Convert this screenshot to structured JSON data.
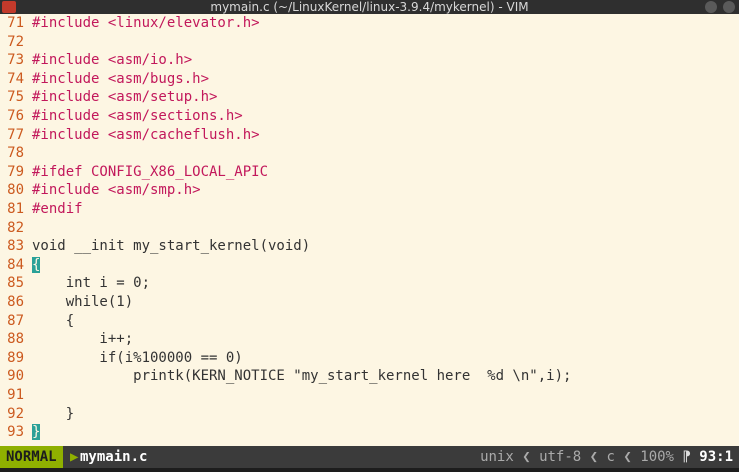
{
  "window": {
    "title": "mymain.c (~/LinuxKernel/linux-3.9.4/mykernel) - VIM"
  },
  "editor": {
    "lines": [
      {
        "n": "71",
        "text": "#include <linux/elevator.h>"
      },
      {
        "n": "72",
        "text": ""
      },
      {
        "n": "73",
        "text": "#include <asm/io.h>"
      },
      {
        "n": "74",
        "text": "#include <asm/bugs.h>"
      },
      {
        "n": "75",
        "text": "#include <asm/setup.h>"
      },
      {
        "n": "76",
        "text": "#include <asm/sections.h>"
      },
      {
        "n": "77",
        "text": "#include <asm/cacheflush.h>"
      },
      {
        "n": "78",
        "text": ""
      },
      {
        "n": "79",
        "text": "#ifdef CONFIG_X86_LOCAL_APIC"
      },
      {
        "n": "80",
        "text": "#include <asm/smp.h>"
      },
      {
        "n": "81",
        "text": "#endif"
      },
      {
        "n": "82",
        "text": ""
      },
      {
        "n": "83",
        "text": "void __init my_start_kernel(void)"
      },
      {
        "n": "84",
        "text": "{"
      },
      {
        "n": "85",
        "text": "    int i = 0;"
      },
      {
        "n": "86",
        "text": "    while(1)"
      },
      {
        "n": "87",
        "text": "    {"
      },
      {
        "n": "88",
        "text": "        i++;"
      },
      {
        "n": "89",
        "text": "        if(i%100000 == 0)"
      },
      {
        "n": "90",
        "text": "            printk(KERN_NOTICE \"my_start_kernel here  %d \\n\",i);"
      },
      {
        "n": "91",
        "text": ""
      },
      {
        "n": "92",
        "text": "    }"
      },
      {
        "n": "93",
        "text": "}"
      }
    ]
  },
  "status": {
    "mode": "NORMAL",
    "filename": "mymain.c",
    "fileformat": "unix",
    "encoding": "utf-8",
    "filetype": "c",
    "percent": "100%",
    "position": "93:1"
  },
  "colors": {
    "mode_bg": "#8fb000",
    "statusbar_bg": "#3b3b3b",
    "editor_bg": "#fdf6e3",
    "line_number": "#cc5a1f"
  }
}
